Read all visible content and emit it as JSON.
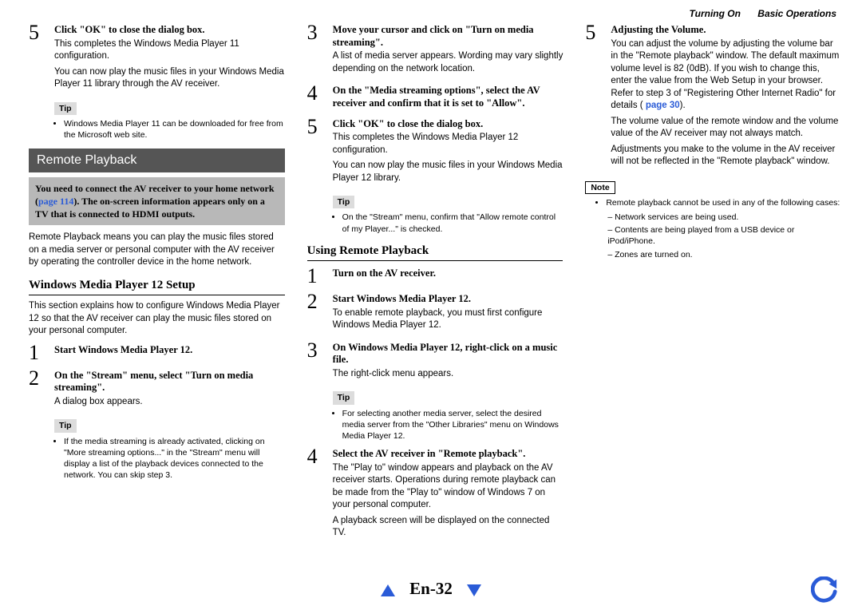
{
  "header": {
    "turning_on": "Turning On",
    "basic": "Basic Operations"
  },
  "col1": {
    "step5": {
      "num": "5",
      "title": "Click \"OK\" to close the dialog box.",
      "body1": "This completes the Windows Media Player 11 configuration.",
      "body2": "You can now play the music files in your Windows Media Player 11 library through the AV receiver."
    },
    "tip_label": "Tip",
    "tip1": "Windows Media Player 11 can be downloaded for free from the Microsoft web site.",
    "section_bar": "Remote Playback",
    "greybox": {
      "pre": "You need to connect the AV receiver to your home network (",
      "pagelink": "page 114",
      "post": "). The on-screen information appears only on a TV that is connected to HDMI outputs."
    },
    "intro": "Remote Playback means you can play the music files stored on a media server or personal computer with the AV receiver by operating the controller device in the home network.",
    "h2": "Windows Media Player 12 Setup",
    "h2_body": "This section explains how to configure Windows Media Player 12 so that the AV receiver can play the music files stored on your personal computer.",
    "step1": {
      "num": "1",
      "title": "Start Windows Media Player 12."
    },
    "step2": {
      "num": "2",
      "title": "On the \"Stream\" menu, select \"Turn on media streaming\".",
      "body": "A dialog box appears."
    },
    "tip2": "If the media streaming is already activated, clicking on \"More streaming options...\" in the \"Stream\" menu will display a list of the playback devices connected to the network. You can skip step 3."
  },
  "col2": {
    "step3": {
      "num": "3",
      "title": "Move your cursor and click on \"Turn on media streaming\".",
      "body": "A list of media server appears. Wording may vary slightly depending on the network location."
    },
    "step4": {
      "num": "4",
      "title": "On the \"Media streaming options\", select the AV receiver and confirm that it is set to \"Allow\"."
    },
    "step5b": {
      "num": "5",
      "title": "Click \"OK\" to close the dialog box.",
      "body1": "This completes the Windows Media Player 12 configuration.",
      "body2": "You can now play the music files in your Windows Media Player 12 library."
    },
    "tip_label": "Tip",
    "tip1": "On the \"Stream\" menu, confirm that \"Allow remote control of my Player...\" is checked.",
    "h2": "Using Remote Playback",
    "step1": {
      "num": "1",
      "title": "Turn on the AV receiver."
    },
    "step2": {
      "num": "2",
      "title": "Start Windows Media Player 12.",
      "body": "To enable remote playback, you must first configure Windows Media Player 12."
    },
    "step3b": {
      "num": "3",
      "title": "On Windows Media Player 12, right-click on a music file.",
      "body": "The right-click menu appears."
    },
    "tip2": "For selecting another media server, select the desired media server from the \"Other Libraries\" menu on Windows Media Player 12.",
    "step4b": {
      "num": "4",
      "title": "Select the AV receiver in \"Remote playback\".",
      "body1": "The \"Play to\" window appears and playback on the AV receiver starts. Operations during remote playback can be made from the \"Play to\" window of Windows 7 on your personal computer.",
      "body2": "A playback screen will be displayed on the connected TV."
    }
  },
  "col3": {
    "step5": {
      "num": "5",
      "title": "Adjusting the Volume.",
      "body1": "You can adjust the volume by adjusting the volume bar in the \"Remote playback\" window. The default maximum volume level is 82 (0dB). If you wish to change this, enter the value from the Web Setup in your browser. Refer to step 3 of \"Registering Other Internet Radio\" for details (",
      "pageref": "page 30",
      "body1_post": ").",
      "body2": "The volume value of the remote window and the volume value of the AV receiver may not always match.",
      "body3": "Adjustments you make to the volume in the AV receiver will not be reflected in the \"Remote playback\" window."
    },
    "note_label": "Note",
    "note_intro": "Remote playback cannot be used in any of the following cases:",
    "note1": "Network services are being used.",
    "note2": "Contents are being played from a USB device or iPod/iPhone.",
    "note3": "Zones are turned on."
  },
  "footer": {
    "pageno": "En-32"
  }
}
